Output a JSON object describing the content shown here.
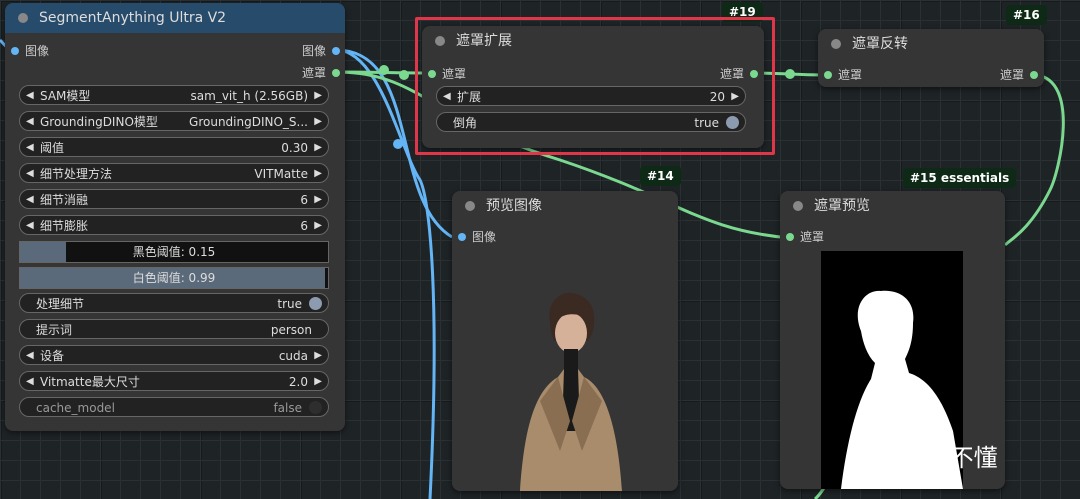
{
  "nodes": {
    "segment": {
      "title": "SegmentAnything Ultra V2",
      "inputs": [
        "图像"
      ],
      "outputs": [
        "图像",
        "遮罩"
      ],
      "widgets": [
        {
          "label": "SAM模型",
          "value": "sam_vit_h (2.56GB)"
        },
        {
          "label": "GroundingDINO模型",
          "value": "GroundingDINO_S..."
        },
        {
          "label": "阈值",
          "value": "0.30"
        },
        {
          "label": "细节处理方法",
          "value": "VITMatte"
        },
        {
          "label": "细节消融",
          "value": "6"
        },
        {
          "label": "细节膨胀",
          "value": "6"
        }
      ],
      "black_threshold": {
        "text": "黑色阈值: 0.15",
        "value": 0.15
      },
      "white_threshold": {
        "text": "白色阈值: 0.99",
        "value": 0.99
      },
      "process_detail": {
        "label": "处理细节",
        "value": "true"
      },
      "prompt": {
        "label": "提示词",
        "value": "person"
      },
      "device": {
        "label": "设备",
        "value": "cuda"
      },
      "vitmatte_max": {
        "label": "Vitmatte最大尺寸",
        "value": "2.0"
      },
      "cache_model": {
        "label": "cache_model",
        "value": "false"
      }
    },
    "mask_grow": {
      "badge": "#19",
      "title": "遮罩扩展",
      "input": "遮罩",
      "output": "遮罩",
      "expand": {
        "label": "扩展",
        "value": "20"
      },
      "tapered": {
        "label": "倒角",
        "value": "true"
      }
    },
    "mask_invert": {
      "badge": "#16",
      "title": "遮罩反转",
      "input": "遮罩",
      "output": "遮罩"
    },
    "preview_image": {
      "badge": "#14",
      "title": "预览图像",
      "input": "图像"
    },
    "mask_preview": {
      "badge": "#15 essentials",
      "title": "遮罩预览",
      "input": "遮罩"
    }
  },
  "watermark": "知乎 @董不懂",
  "colors": {
    "image_link": "#64b5f6",
    "mask_link": "#7bd88f",
    "highlight": "#e0364a"
  }
}
